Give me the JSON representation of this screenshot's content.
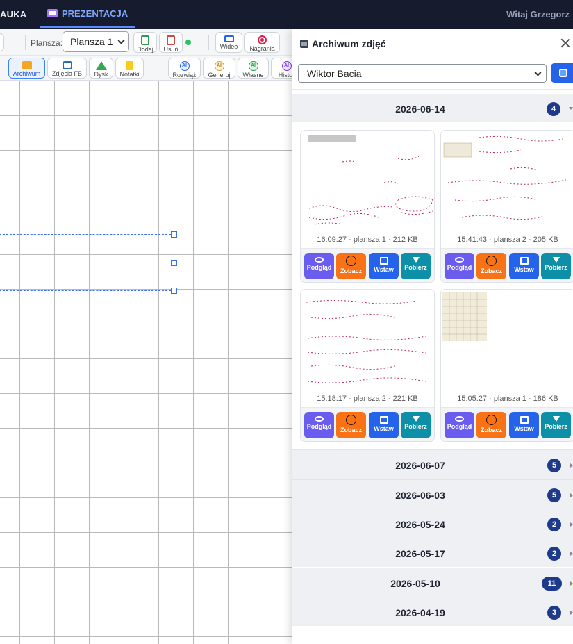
{
  "topnav": {
    "tab_partial": "AUKA",
    "tab_active": "PREZENTACJA",
    "greeting": "Witaj Grzegorz"
  },
  "toolbar1": {
    "board_label": "Plansza:",
    "board_select": "Plansza 1",
    "add_label": "Dodaj",
    "remove_label": "Usuń",
    "video_label": "Wideo",
    "recordings_label": "Nagrania"
  },
  "toolbar2": {
    "archive_label": "Archiwum",
    "fb_photos_label": "Zdjęcia FB",
    "drive_label": "Dysk",
    "notes_label": "Notatki",
    "solve_label": "Rozwiąż",
    "generate_label": "Generuj",
    "own_label": "Własne",
    "history_label": "Histor",
    "ai_badge": "AI"
  },
  "archive": {
    "title": "Archiwum zdjęć",
    "student_select": "Wiktor Bacia",
    "groups": [
      {
        "date": "2026-06-14",
        "count": "4",
        "expanded": true,
        "photos": [
          {
            "time": "16:09:27",
            "board": "plansza 1",
            "size": "212 KB"
          },
          {
            "time": "15:41:43",
            "board": "plansza 2",
            "size": "205 KB"
          },
          {
            "time": "15:18:17",
            "board": "plansza 2",
            "size": "221 KB"
          },
          {
            "time": "15:05:27",
            "board": "plansza 1",
            "size": "186 KB"
          }
        ]
      },
      {
        "date": "2026-06-07",
        "count": "5",
        "expanded": false
      },
      {
        "date": "2026-06-03",
        "count": "5",
        "expanded": false
      },
      {
        "date": "2026-05-24",
        "count": "2",
        "expanded": false
      },
      {
        "date": "2026-05-17",
        "count": "2",
        "expanded": false
      },
      {
        "date": "2026-05-10",
        "count": "11",
        "expanded": false
      },
      {
        "date": "2026-04-19",
        "count": "3",
        "expanded": false
      }
    ],
    "card_actions": {
      "preview": "Podgląd",
      "view": "Zobacz",
      "insert": "Wstaw",
      "download": "Pobierz"
    },
    "photo_metas": [
      "16:09:27 · plansza 1 · 212 KB",
      "15:41:43 · plansza 2 · 205 KB",
      "15:18:17 · plansza 2 · 221 KB",
      "15:05:27 · plansza 1 · 186 KB"
    ]
  },
  "colors": {
    "nav_bg": "#161b2e",
    "accent": "#2563eb",
    "badge": "#1e3a8a",
    "preview_btn": "#6b5cf0",
    "view_btn": "#f97316",
    "insert_btn": "#2563eb",
    "download_btn": "#0e8fa8"
  },
  "icons": {
    "archive_title": "image-icon",
    "close": "close-icon",
    "refresh": "refresh-icon",
    "preview": "eye-icon",
    "view": "circle-icon",
    "insert": "image-insert-icon",
    "download": "download-icon"
  }
}
